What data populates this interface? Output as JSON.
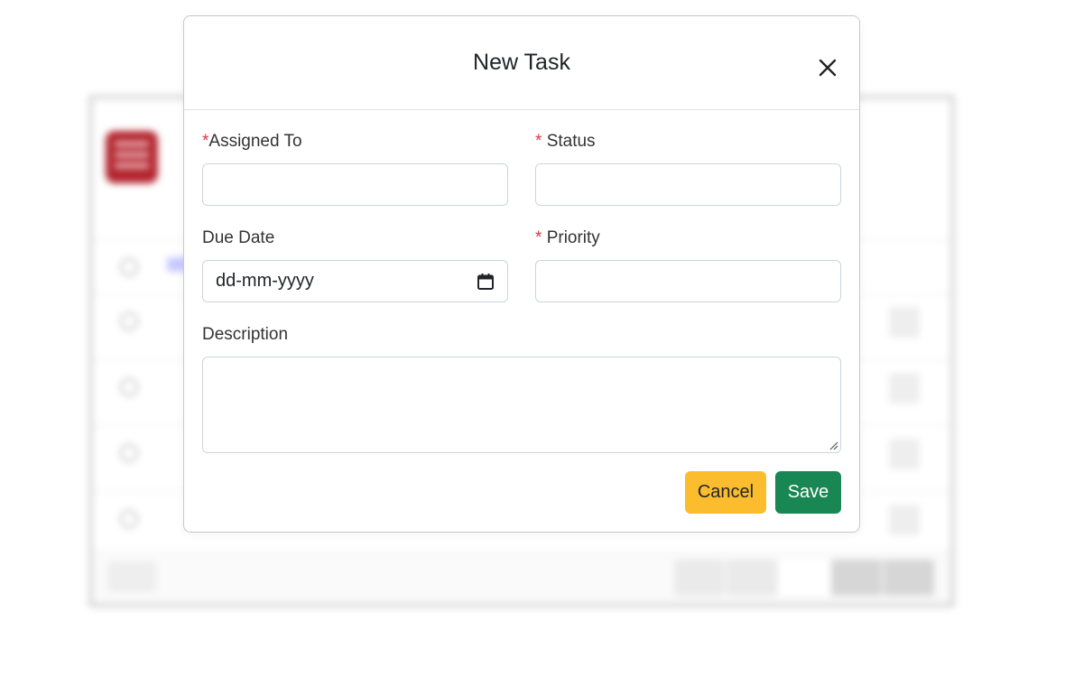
{
  "modal": {
    "title": "New Task",
    "close_icon": "close-icon",
    "fields": {
      "assigned_to": {
        "label": "Assigned To",
        "required_mark": "*",
        "value": ""
      },
      "status": {
        "label": "Status",
        "required_mark": "*",
        "value": ""
      },
      "due_date": {
        "label": "Due Date",
        "placeholder": "dd-mm-yyyy",
        "icon": "calendar-icon"
      },
      "priority": {
        "label": "Priority",
        "required_mark": "*",
        "value": ""
      },
      "description": {
        "label": "Description",
        "value": ""
      }
    },
    "buttons": {
      "cancel": "Cancel",
      "save": "Save"
    }
  },
  "colors": {
    "required": "#dc3545",
    "cancel_bg": "#fbbd2d",
    "save_bg": "#198754",
    "logo_bg": "#b3262f"
  }
}
